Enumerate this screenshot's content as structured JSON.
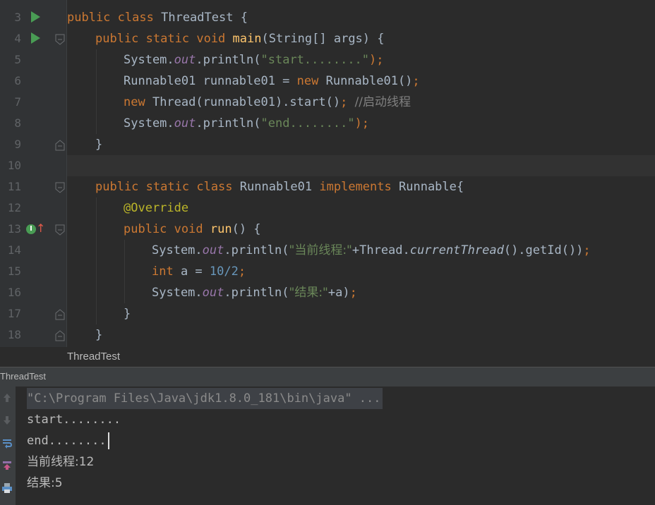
{
  "editor": {
    "line_numbers": [
      "3",
      "4",
      "5",
      "6",
      "7",
      "8",
      "9",
      "10",
      "11",
      "12",
      "13",
      "14",
      "15",
      "16",
      "17",
      "18"
    ],
    "code": {
      "l3": {
        "kw1": "public",
        "kw2": "class",
        "name": "ThreadTest",
        "brace": "{"
      },
      "l4": {
        "kw1": "public",
        "kw2": "static",
        "kw3": "void",
        "fn": "main",
        "rest": "(String[] args) {"
      },
      "l5": {
        "pre": "System.",
        "field": "out",
        "mid": ".println(",
        "str": "\"start........\"",
        "end": ");"
      },
      "l6": {
        "pre": "Runnable01 runnable01 = ",
        "kw": "new",
        "mid": " Runnable01()",
        "end": ";"
      },
      "l7": {
        "kw": "new",
        "mid": " Thread(runnable01).start()",
        "semi": ";",
        "comment": "//启动线程"
      },
      "l8": {
        "pre": "System.",
        "field": "out",
        "mid": ".println(",
        "str": "\"end........\"",
        "end": ");"
      },
      "l9": {
        "text": "}"
      },
      "l11": {
        "kw1": "public",
        "kw2": "static",
        "kw3": "class",
        "name": "Runnable01",
        "kw4": "implements",
        "iface": "Runnable{"
      },
      "l12": {
        "ann": "@Override"
      },
      "l13": {
        "kw1": "public",
        "kw2": "void",
        "fn": "run",
        "rest": "() {"
      },
      "l14": {
        "pre": "System.",
        "field": "out",
        "mid": ".println(",
        "str": "\"当前线程:\"",
        "concat": "+Thread.",
        "static": "currentThread",
        "tail": "().getId())",
        "end": ";"
      },
      "l15": {
        "kw": "int",
        "mid": " a = ",
        "n1": "10",
        "op": "/",
        "n2": "2",
        "end": ";"
      },
      "l16": {
        "pre": "System.",
        "field": "out",
        "mid": ".println(",
        "str": "\"结果:\"",
        "tail": "+a)",
        "end": ";"
      },
      "l17": {
        "text": "}"
      },
      "l18": {
        "text": "}"
      }
    },
    "breadcrumb": "ThreadTest",
    "gutter_icons": {
      "run_main": "run-triangle-icon",
      "implements": "I"
    }
  },
  "run_panel": {
    "title": "ThreadTest",
    "toolbar": [
      "up-arrow-icon",
      "down-arrow-icon",
      "soft-wrap-icon",
      "scroll-to-end-icon",
      "print-icon"
    ],
    "console_lines": [
      "\"C:\\Program Files\\Java\\jdk1.8.0_181\\bin\\java\" ...",
      "start........",
      "end........",
      "当前线程:12",
      "结果:5"
    ]
  },
  "colors": {
    "keyword": "#cc7832",
    "string": "#6a8759",
    "field": "#9876aa",
    "method": "#ffc66d",
    "annotation": "#bbb529",
    "number": "#6897bb",
    "comment": "#808080",
    "text": "#a9b7c6",
    "background": "#2b2b2b"
  }
}
